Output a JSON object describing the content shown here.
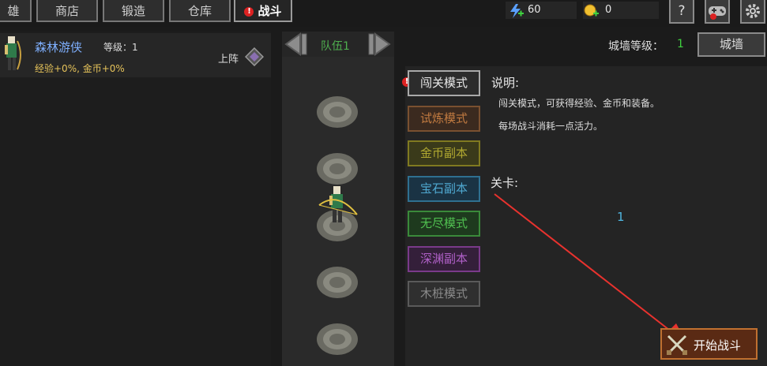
{
  "tabs": [
    {
      "label": "雄"
    },
    {
      "label": "商店"
    },
    {
      "label": "锻造"
    },
    {
      "label": "仓库"
    },
    {
      "label": "战斗"
    }
  ],
  "resources": {
    "energy": "60",
    "gold": "0"
  },
  "hero": {
    "name": "森林游侠",
    "level": "等级：1",
    "bonus": "经验+0%, 金币+0%",
    "deploy_label": "上阵"
  },
  "team": {
    "label": "队伍1"
  },
  "wall": {
    "level_label": "城墙等级：",
    "level_value": "1",
    "button": "城墙"
  },
  "modes": [
    {
      "label": "闯关模式"
    },
    {
      "label": "试炼模式"
    },
    {
      "label": "金币副本"
    },
    {
      "label": "宝石副本"
    },
    {
      "label": "无尽模式"
    },
    {
      "label": "深渊副本"
    },
    {
      "label": "木桩模式"
    }
  ],
  "description": {
    "title": "说明:",
    "line1": "闯关模式，可获得经验、金币和装备。",
    "line2": "每场战斗消耗一点活力。"
  },
  "stage": {
    "title": "关卡:",
    "value": "1"
  },
  "start_button": "开始战斗",
  "colors": {
    "gold_text": "#e6c35a",
    "hero_name": "#7fb0ff",
    "wall_level": "#3fd03f",
    "stage_value": "#4fb6e0",
    "arrow": "#e8322e"
  }
}
